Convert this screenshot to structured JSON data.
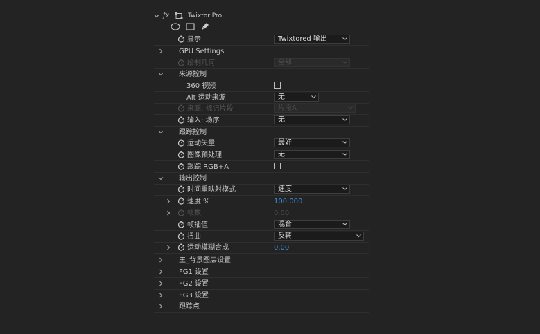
{
  "effect": {
    "name": "Twixtor Pro"
  },
  "rows": [
    {
      "id": "display",
      "label": "显示",
      "stopwatch": true,
      "control": "dropdown",
      "value": "Twixtored 输出",
      "w": 110
    },
    {
      "id": "gpu",
      "label": "GPU Settings",
      "twirl": true,
      "control": "none"
    },
    {
      "id": "draw_geom",
      "label": "绘制几何",
      "stopwatch": true,
      "disabled": true,
      "control": "dropdown",
      "value": "全部",
      "w": 110
    },
    {
      "id": "source_ctrl",
      "label": "来源控制",
      "twirl": true,
      "open": true,
      "control": "none",
      "group": true
    },
    {
      "id": "v360",
      "label": "360 视频",
      "control": "checkbox"
    },
    {
      "id": "alt_src",
      "label": "Alt 运动来源",
      "control": "dropdown",
      "value": "无",
      "w": 65
    },
    {
      "id": "src_mark",
      "label": "来源: 标记片段",
      "stopwatch": true,
      "disabled": true,
      "control": "dropdown",
      "value": "片段A",
      "w": 118
    },
    {
      "id": "input_field",
      "label": "输入: 场序",
      "stopwatch": true,
      "control": "dropdown",
      "value": "无",
      "w": 110
    },
    {
      "id": "track_ctrl",
      "label": "跟踪控制",
      "twirl": true,
      "open": true,
      "control": "none",
      "group": true
    },
    {
      "id": "motion_vec",
      "label": "运动矢量",
      "stopwatch": true,
      "control": "dropdown",
      "value": "最好",
      "w": 110
    },
    {
      "id": "img_pre",
      "label": "图像预处理",
      "stopwatch": true,
      "control": "dropdown",
      "value": "无",
      "w": 110
    },
    {
      "id": "track_rgba",
      "label": "跟踪 RGB+A",
      "stopwatch": true,
      "control": "checkbox"
    },
    {
      "id": "out_ctrl",
      "label": "输出控制",
      "twirl": true,
      "open": true,
      "control": "none",
      "group": true
    },
    {
      "id": "remap_mode",
      "label": "时间重映射模式",
      "stopwatch": true,
      "control": "dropdown",
      "value": "速度",
      "w": 110
    },
    {
      "id": "speed",
      "label": "速度 %",
      "stopwatch": true,
      "twirl": true,
      "control": "number",
      "value": "100.000"
    },
    {
      "id": "frame",
      "label": "帧数",
      "stopwatch": true,
      "twirl": true,
      "disabled": true,
      "control": "number",
      "value": "0.00"
    },
    {
      "id": "interp",
      "label": "帧插值",
      "stopwatch": true,
      "control": "dropdown",
      "value": "混合",
      "w": 110
    },
    {
      "id": "warp",
      "label": "扭曲",
      "stopwatch": true,
      "control": "dropdown",
      "value": "反转",
      "w": 130
    },
    {
      "id": "mblur",
      "label": "运动模糊合成",
      "stopwatch": true,
      "twirl": true,
      "control": "number",
      "value": "0.00"
    },
    {
      "id": "main_bg",
      "label": "主_背景图层设置",
      "twirl": true,
      "control": "none",
      "group": true
    },
    {
      "id": "fg1",
      "label": "FG1 设置",
      "twirl": true,
      "control": "none",
      "group": true
    },
    {
      "id": "fg2",
      "label": "FG2 设置",
      "twirl": true,
      "control": "none",
      "group": true
    },
    {
      "id": "fg3",
      "label": "FG3 设置",
      "twirl": true,
      "control": "none",
      "group": true
    },
    {
      "id": "trackpts",
      "label": "跟踪点",
      "twirl": true,
      "control": "none",
      "group": true
    }
  ]
}
